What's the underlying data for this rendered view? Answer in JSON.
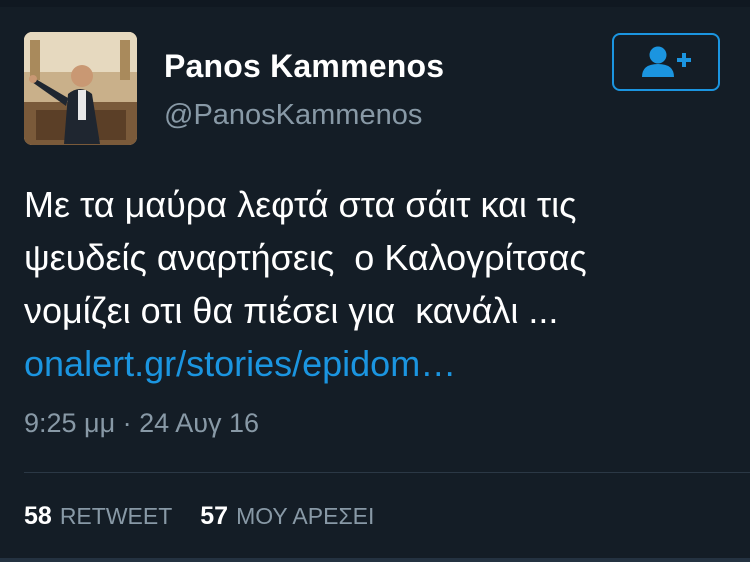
{
  "tweet": {
    "author": {
      "display_name": "Panos Kammenos",
      "handle": "@PanosKammenos",
      "avatar_icon": "profile-photo"
    },
    "follow_icon": "add-user-icon",
    "text_lines": [
      "Με τα μαύρα λεφτά στα σάιτ και τις",
      "ψευδείς αναρτήσεις  ο Καλογρίτσας",
      "νομίζει οτι θα πιέσει για  κανάλι ..."
    ],
    "link_text": "onalert.gr/stories/epidom…",
    "timestamp": "9:25 μμ · 24 Αυγ 16",
    "stats": {
      "retweet_count": "58",
      "retweet_label": "RETWEET",
      "like_count": "57",
      "like_label": "ΜΟΥ ΑΡΕΣΕΙ"
    }
  },
  "colors": {
    "background": "#141d26",
    "accent": "#1b95e0",
    "secondary_text": "#8899a6"
  }
}
